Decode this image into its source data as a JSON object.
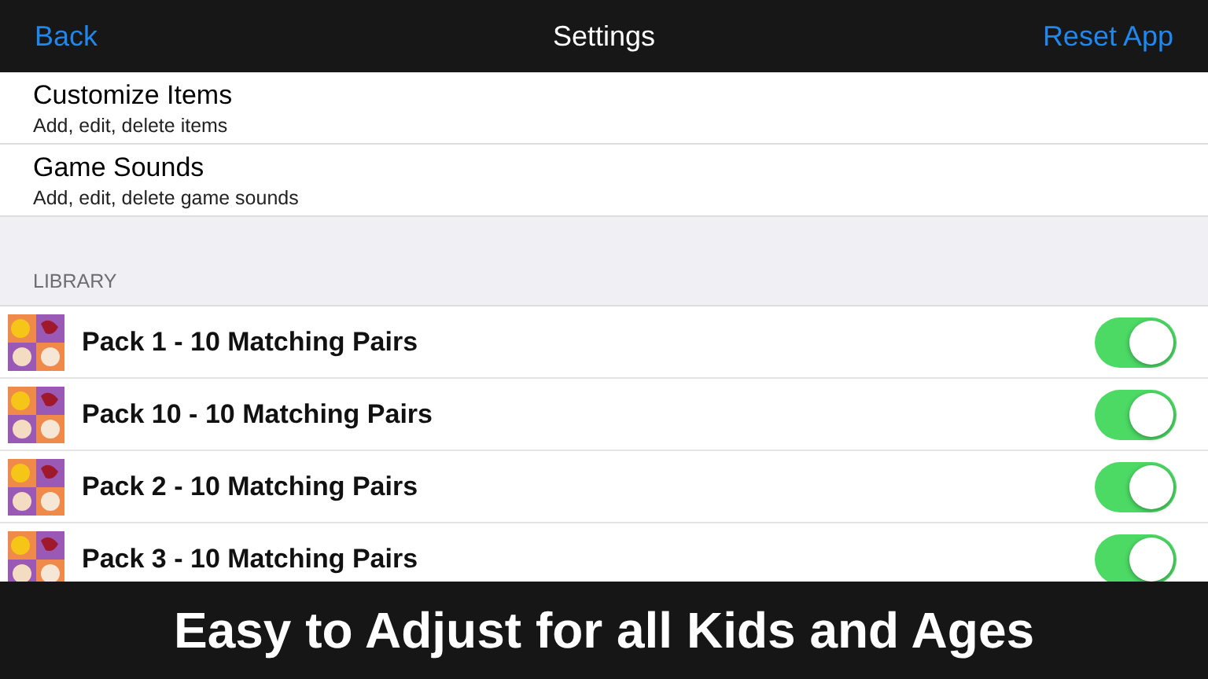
{
  "nav": {
    "back": "Back",
    "title": "Settings",
    "action": "Reset App"
  },
  "customization": [
    {
      "title": "Customize Items",
      "subtitle": "Add, edit, delete items"
    },
    {
      "title": "Game Sounds",
      "subtitle": "Add, edit, delete game sounds"
    }
  ],
  "library": {
    "header": "LIBRARY",
    "packs": [
      {
        "label": "Pack 1 - 10 Matching Pairs",
        "on": true
      },
      {
        "label": "Pack 10 - 10 Matching Pairs",
        "on": true
      },
      {
        "label": "Pack 2 - 10 Matching Pairs",
        "on": true
      },
      {
        "label": "Pack 3 - 10 Matching Pairs",
        "on": true
      }
    ]
  },
  "banner": "Easy to Adjust for all Kids and Ages"
}
